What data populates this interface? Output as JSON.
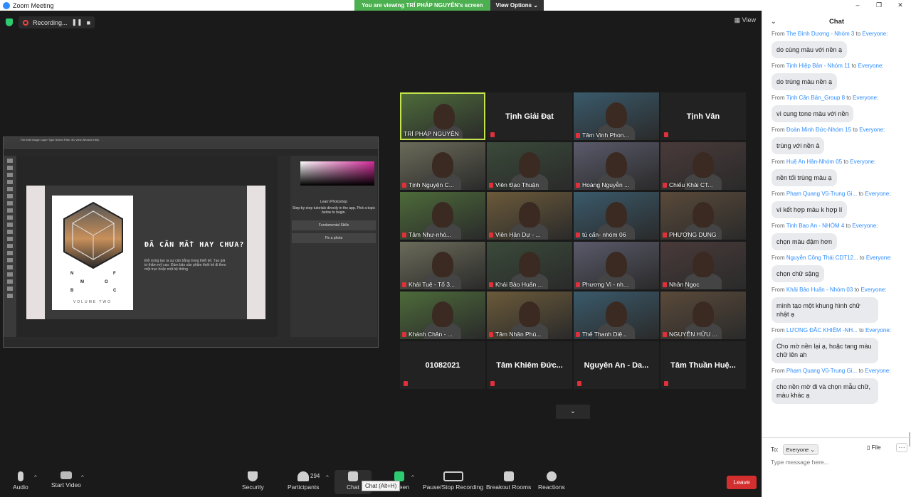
{
  "window": {
    "title": "Zoom Meeting",
    "controls": [
      "–",
      "❐",
      "✕"
    ]
  },
  "banner": {
    "message": "You are viewing TRÍ PHÁP NGUYÊN's screen",
    "view_options": "View Options ⌄"
  },
  "top": {
    "recording": "Recording...",
    "pause": "❚❚",
    "stop": "■",
    "view": "View"
  },
  "share": {
    "menu": "File  Edit  Image  Layer  Type  Select  Filter  3D  View  Window  Help",
    "slide_title": "ĐÃ CĂN MẮT HAY CHƯA?",
    "slide_text": "Đối xứng tạo ra sự cân bằng trong thiết kế. Tạo giá trị thẩm mỹ cao. Đảm bảo sản phẩm thiết kế đi theo một trục hoặc một hệ thống",
    "card_letters": [
      "N",
      "F",
      "M",
      "O",
      "B",
      "C"
    ],
    "card_footer": "VOLUME TWO",
    "learn_title": "Learn Photoshop",
    "learn_text": "Step-by-step tutorials directly in the app. Pick a topic below to begin.",
    "learn_item1": "Fundamental Skills",
    "learn_item2": "Fix a photo"
  },
  "participants": [
    {
      "name": "TRÍ PHÁP NGUYÊN",
      "video": true,
      "active": true,
      "muted": false
    },
    {
      "name": "Tịnh Giải Đạt",
      "video": false,
      "muted": true
    },
    {
      "name": "Tâm Vinh Phon...",
      "video": true,
      "muted": true
    },
    {
      "name": "Tịnh Vân",
      "video": false,
      "muted": true
    },
    {
      "name": "Tịnh Nguyện C...",
      "video": true,
      "muted": true
    },
    {
      "name": "Viên Đạo Thuận",
      "video": true,
      "muted": true
    },
    {
      "name": "Hoàng Nguyễn ...",
      "video": true,
      "muted": true
    },
    {
      "name": "Chiếu Khải CT...",
      "video": true,
      "muted": true
    },
    {
      "name": "Tâm Như-nhó...",
      "video": true,
      "muted": true
    },
    {
      "name": "Viên Hân Dự - ...",
      "video": true,
      "muted": true
    },
    {
      "name": "tú cẩn- nhóm 06",
      "video": true,
      "muted": true
    },
    {
      "name": "PHƯƠNG DUNG",
      "video": true,
      "muted": true
    },
    {
      "name": "Khải Tuệ - Tổ 3...",
      "video": true,
      "muted": true
    },
    {
      "name": "Khải Bảo Huấn ...",
      "video": true,
      "muted": true
    },
    {
      "name": "Phương Vi - nh...",
      "video": true,
      "muted": true
    },
    {
      "name": "Nhân Ngọc",
      "video": true,
      "muted": true
    },
    {
      "name": "Khánh Chân - ...",
      "video": true,
      "muted": true
    },
    {
      "name": "Tâm Nhân Phú...",
      "video": true,
      "muted": true
    },
    {
      "name": "Thế Thanh Diệ...",
      "video": true,
      "muted": true
    },
    {
      "name": "NGUYỄN HỮU ...",
      "video": true,
      "muted": true
    },
    {
      "name": "01082021",
      "video": false,
      "muted": true
    },
    {
      "name": "Tâm Khiêm Đức...",
      "video": false,
      "muted": true
    },
    {
      "name": "Nguyên An - Da...",
      "video": false,
      "muted": true
    },
    {
      "name": "Tâm Thuần Huệ...",
      "video": false,
      "muted": true
    }
  ],
  "grid_more": "⌄",
  "toolbar": {
    "audio": "Audio",
    "start_video": "Start Video",
    "security": "Security",
    "participants": "Participants",
    "participants_count": "294",
    "chat": "Chat",
    "share_screen": "Screen",
    "recording": "Pause/Stop Recording",
    "breakout": "Breakout Rooms",
    "reactions": "Reactions",
    "leave": "Leave",
    "caret": "^",
    "chat_tooltip": "Chat (Alt+H)"
  },
  "chat": {
    "title": "Chat",
    "collapse": "⌄",
    "messages": [
      {
        "from": "The Đình Dương - Nhóm 3",
        "to": "Everyone:",
        "text": "do cùng màu với nền ạ"
      },
      {
        "from": "Tịnh Hiệp Bản - Nhóm 11",
        "to": "Everyone:",
        "text": "do trùng màu nền ạ"
      },
      {
        "from": "Tịnh Cần Bản_Group 8",
        "to": "Everyone:",
        "text": "vì cung tone màu với nền"
      },
      {
        "from": "Đoàn Minh Đức-Nhóm 15",
        "to": "Everyone:",
        "text": "trùng với nền ả"
      },
      {
        "from": "Huệ An Hân-Nhóm 05",
        "to": "Everyone:",
        "text": "nền tối trùng màu ạ"
      },
      {
        "from": "Phạm Quang Vũ-Trung Gi...",
        "to": "Everyone:",
        "text": "vì kết hợp màu k hợp lí"
      },
      {
        "from": "Tinh Bao An - NHÓM 4",
        "to": "Everyone:",
        "text": "chọn màu đậm hơn"
      },
      {
        "from": "Nguyễn Công Thái CDT12...",
        "to": "Everyone:",
        "text": "chọn chữ sậng"
      },
      {
        "from": "Khải Bảo Huấn - Nhóm 03",
        "to": "Everyone:",
        "text": "mình tạo một khung hình chữ nhật ạ"
      },
      {
        "from": "LƯƠNG ĐẮC KHIÊM -NH...",
        "to": "Everyone:",
        "text": "Cho mờ nền lại ạ, hoặc tang màu chữ lên ah"
      },
      {
        "from": "Phạm Quang Vũ-Trung Gi...",
        "to": "Everyone:",
        "text": "cho nền mờ đi và chọn mẫu chữ, màu khác ạ"
      }
    ],
    "from_label": "From",
    "to_label": "to",
    "recipient_label": "To:",
    "recipient": "Everyone ⌄",
    "file": "File",
    "more": "···",
    "placeholder": "Type message here..."
  },
  "colors": {
    "accent": "#2d8cff",
    "leave": "#d32f2f",
    "banner": "#4caf50",
    "active_border": "#c5e34a"
  }
}
